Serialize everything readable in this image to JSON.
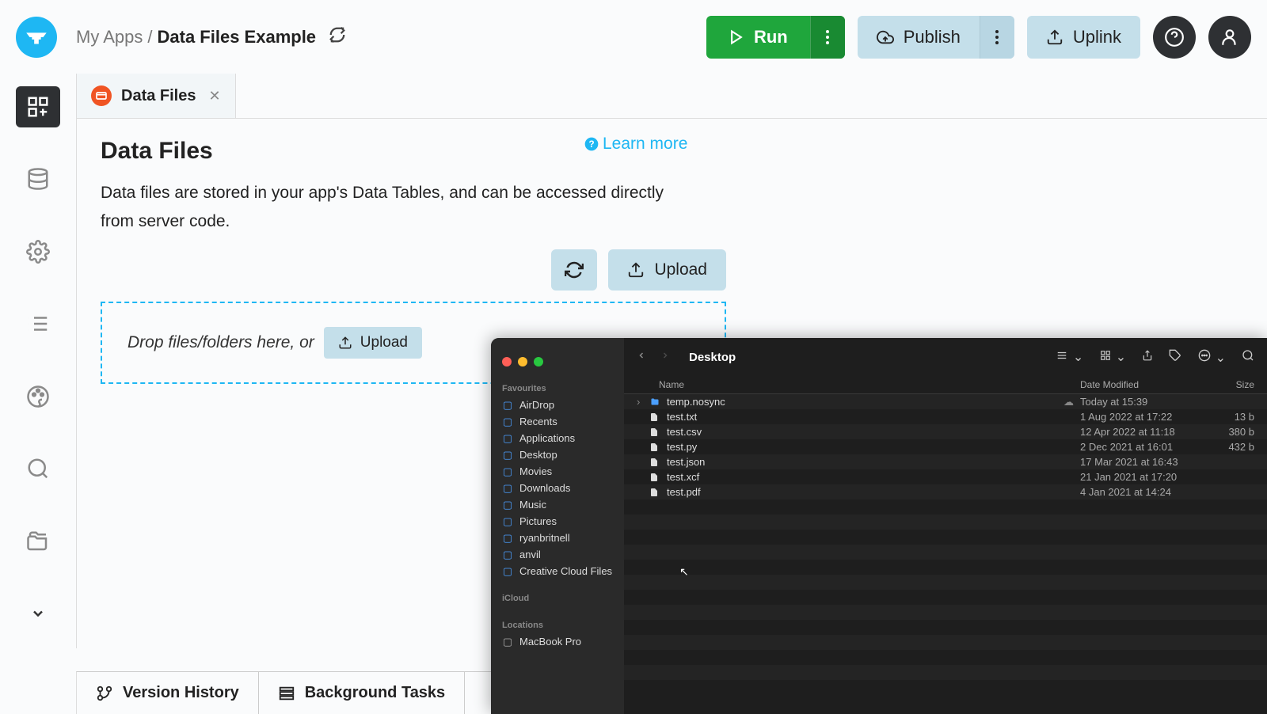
{
  "header": {
    "breadcrumb_root": "My Apps",
    "breadcrumb_current": "Data Files Example",
    "run_label": "Run",
    "publish_label": "Publish",
    "uplink_label": "Uplink"
  },
  "tab": {
    "label": "Data Files"
  },
  "content": {
    "learn_more": "Learn more",
    "title": "Data Files",
    "description": "Data files are stored in your app's Data Tables, and can be accessed directly from server code.",
    "upload_label": "Upload",
    "dropzone_text": "Drop files/folders here, or",
    "upload_small_label": "Upload"
  },
  "bottom": {
    "version_history": "Version History",
    "background_tasks": "Background Tasks"
  },
  "finder": {
    "title": "Desktop",
    "sections": {
      "favourites": "Favourites",
      "icloud": "iCloud",
      "locations": "Locations"
    },
    "sidebar": [
      {
        "label": "AirDrop",
        "icon": "airdrop"
      },
      {
        "label": "Recents",
        "icon": "clock"
      },
      {
        "label": "Applications",
        "icon": "apps"
      },
      {
        "label": "Desktop",
        "icon": "desktop"
      },
      {
        "label": "Movies",
        "icon": "movies"
      },
      {
        "label": "Downloads",
        "icon": "downloads"
      },
      {
        "label": "Music",
        "icon": "music"
      },
      {
        "label": "Pictures",
        "icon": "pictures"
      },
      {
        "label": "ryanbritnell",
        "icon": "home"
      },
      {
        "label": "anvil",
        "icon": "folder"
      },
      {
        "label": "Creative Cloud Files",
        "icon": "folder"
      }
    ],
    "locations": [
      {
        "label": "MacBook Pro",
        "icon": "laptop"
      }
    ],
    "columns": {
      "name": "Name",
      "date": "Date Modified",
      "size": "Size"
    },
    "files": [
      {
        "name": "temp.nosync",
        "date": "Today at 15:39",
        "size": "",
        "folder": true,
        "cloud": true
      },
      {
        "name": "test.txt",
        "date": "1 Aug 2022 at 17:22",
        "size": "13 b"
      },
      {
        "name": "test.csv",
        "date": "12 Apr 2022 at 11:18",
        "size": "380 b"
      },
      {
        "name": "test.py",
        "date": "2 Dec 2021 at 16:01",
        "size": "432 b"
      },
      {
        "name": "test.json",
        "date": "17 Mar 2021 at 16:43",
        "size": ""
      },
      {
        "name": "test.xcf",
        "date": "21 Jan 2021 at 17:20",
        "size": ""
      },
      {
        "name": "test.pdf",
        "date": "4 Jan 2021 at 14:24",
        "size": ""
      }
    ]
  }
}
